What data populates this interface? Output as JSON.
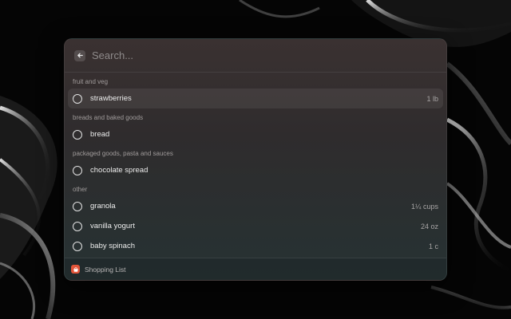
{
  "search": {
    "placeholder": "Search..."
  },
  "sections": [
    {
      "title": "fruit and veg",
      "items": [
        {
          "name": "strawberries",
          "quantity": "1 lb",
          "selected": true
        }
      ]
    },
    {
      "title": "breads and baked goods",
      "items": [
        {
          "name": "bread",
          "quantity": ""
        }
      ]
    },
    {
      "title": "packaged goods, pasta and sauces",
      "items": [
        {
          "name": "chocolate spread",
          "quantity": ""
        }
      ]
    },
    {
      "title": "other",
      "items": [
        {
          "name": "granola",
          "quantity": "1¼ cups"
        },
        {
          "name": "vanilla yogurt",
          "quantity": "24 oz"
        },
        {
          "name": "baby spinach",
          "quantity": "1 c"
        }
      ]
    }
  ],
  "footer": {
    "label": "Shopping List"
  },
  "colors": {
    "accent": "#e2553a"
  }
}
